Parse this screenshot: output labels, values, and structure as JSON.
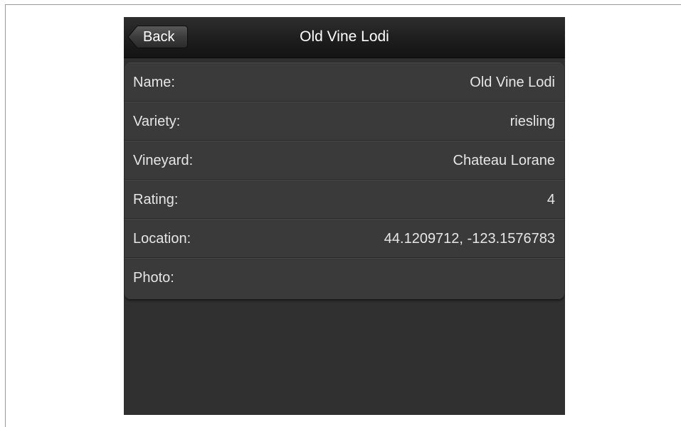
{
  "navbar": {
    "title": "Old Vine Lodi",
    "back_label": "Back"
  },
  "details": {
    "rows": [
      {
        "label": "Name:",
        "value": "Old Vine Lodi"
      },
      {
        "label": "Variety:",
        "value": "riesling"
      },
      {
        "label": "Vineyard:",
        "value": "Chateau Lorane"
      },
      {
        "label": "Rating:",
        "value": "4"
      },
      {
        "label": "Location:",
        "value": "44.1209712, -123.1576783"
      },
      {
        "label": "Photo:",
        "value": ""
      }
    ]
  },
  "colors": {
    "background": "#303030",
    "navbar": "#1c1c1c",
    "row": "#3a3a3a",
    "text": "#e6e6e6"
  }
}
